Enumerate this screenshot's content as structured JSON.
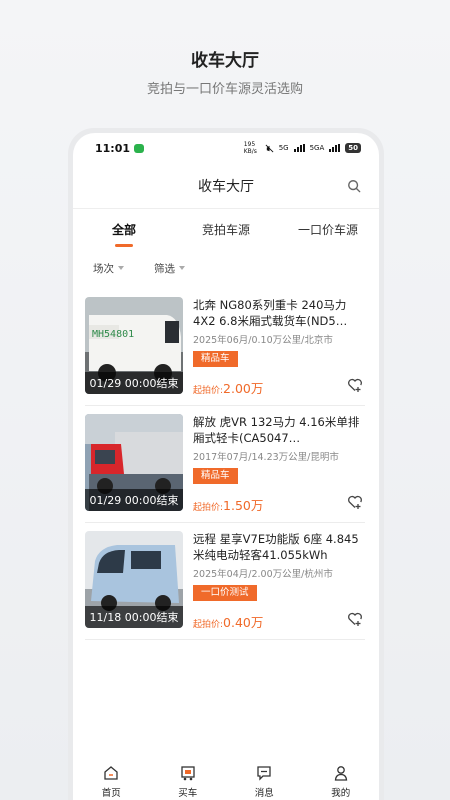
{
  "promo": {
    "title": "收车大厅",
    "subtitle": "竞拍与一口价车源灵活选购"
  },
  "status_bar": {
    "time": "11:01",
    "speed": "195 KB/s",
    "net1": "5G",
    "net2": "5GA",
    "battery": "50"
  },
  "navbar": {
    "title": "收车大厅",
    "icon": "search-icon"
  },
  "tabs": [
    {
      "label": "全部",
      "active": true
    },
    {
      "label": "竞拍车源",
      "active": false
    },
    {
      "label": "一口价车源",
      "active": false
    }
  ],
  "filters": [
    {
      "label": "场次"
    },
    {
      "label": "筛选"
    }
  ],
  "listings": [
    {
      "title": "北奔 NG80系列重卡 240马力 4X2 6.8米厢式载货车(ND5…",
      "meta": "2025年06月/0.10万公里/北京市",
      "tag": "精品车",
      "price_label": "起拍价:",
      "price": "2.00万",
      "end_time": "01/29 00:00结束"
    },
    {
      "title": "解放 虎VR 132马力 4.16米单排厢式轻卡(CA5047…",
      "meta": "2017年07月/14.23万公里/昆明市",
      "tag": "精品车",
      "price_label": "起拍价:",
      "price": "1.50万",
      "end_time": "01/29 00:00结束"
    },
    {
      "title": "远程 星享V7E功能版 6座 4.845米纯电动轻客41.055kWh",
      "meta": "2025年04月/2.00万公里/杭州市",
      "tag": "一口价测试",
      "price_label": "起拍价:",
      "price": "0.40万",
      "end_time": "11/18 00:00结束"
    }
  ],
  "bottom_nav": [
    {
      "label": "首页",
      "icon": "home-icon"
    },
    {
      "label": "买车",
      "icon": "car-icon"
    },
    {
      "label": "消息",
      "icon": "message-icon"
    },
    {
      "label": "我的",
      "icon": "user-icon"
    }
  ],
  "colors": {
    "accent": "#f06a2a",
    "status_green": "#2bb24c"
  }
}
